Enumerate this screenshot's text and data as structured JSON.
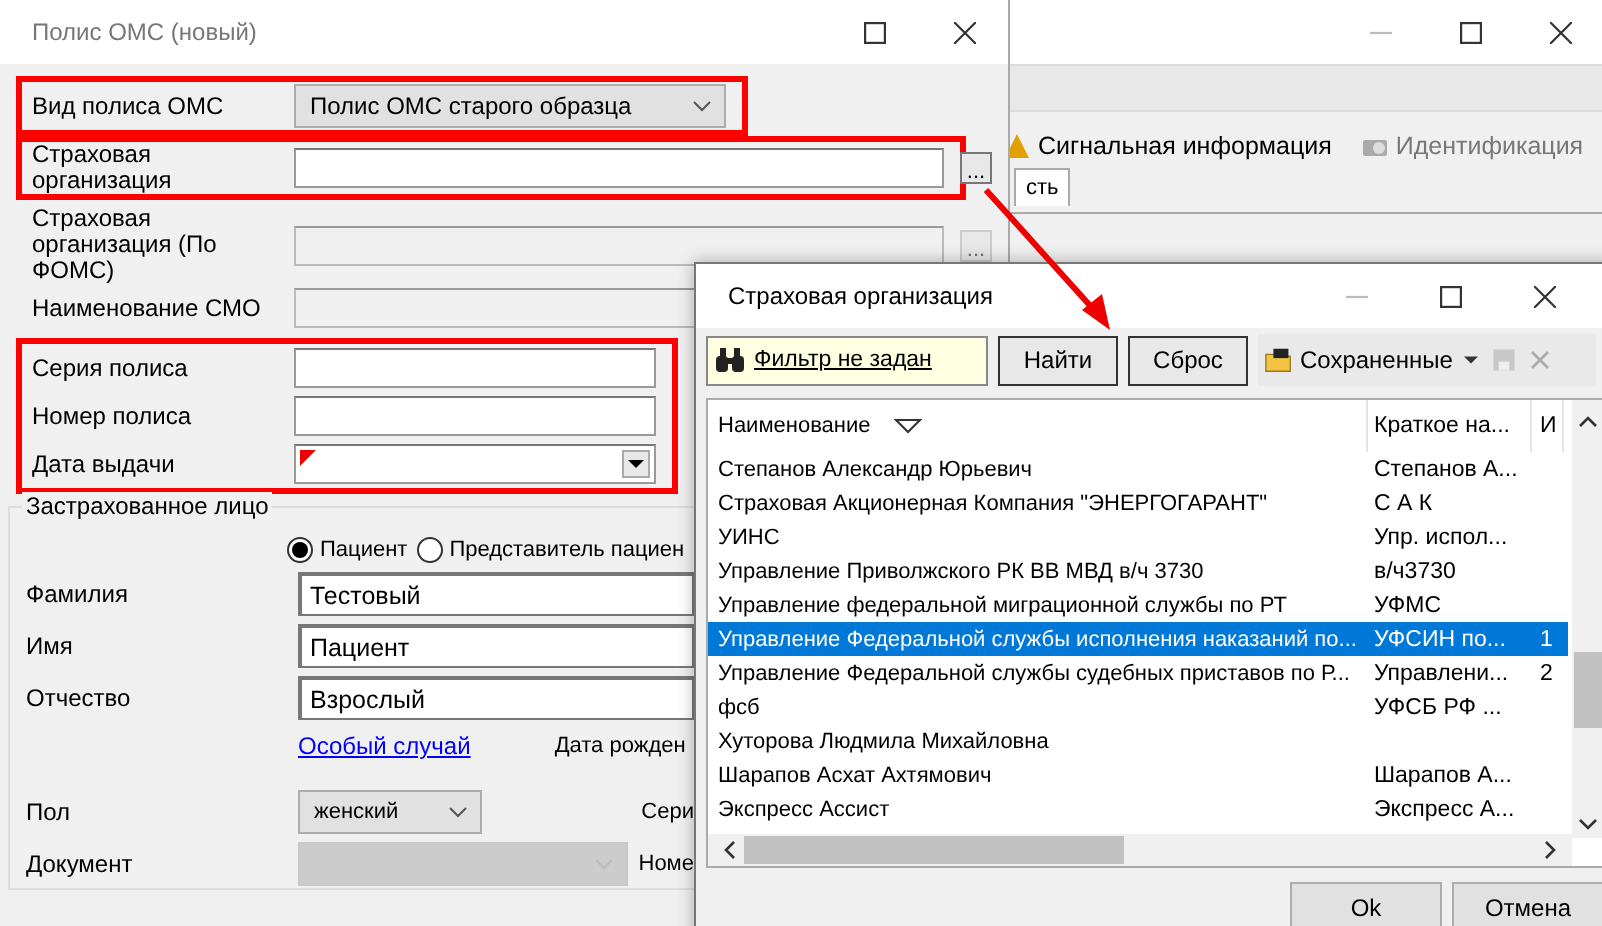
{
  "background_window": {
    "toolbar": [
      {
        "label": "Сигнальная информация",
        "disabled": false
      },
      {
        "label": "Идентификация",
        "disabled": true
      }
    ],
    "tab": {
      "label": "сть"
    }
  },
  "policy_dialog": {
    "title": "Полис ОМС (новый)",
    "groups": [
      {
        "highlighted": true,
        "fields": [
          {
            "kind": "select",
            "label": "Вид полиса ОМС",
            "value": "Полис ОМС старого образца",
            "disabled": false
          }
        ]
      },
      {
        "highlighted": true,
        "fields": [
          {
            "kind": "lookup",
            "label": "Страховая организация",
            "browse_label": "...",
            "disabled": false
          }
        ]
      },
      {
        "highlighted": false,
        "fields": [
          {
            "kind": "lookup",
            "label": "Страховая  организация (По ФОМС)",
            "browse_label": "...",
            "disabled": true
          },
          {
            "kind": "text",
            "label": "Наименование СМО",
            "disabled": true
          }
        ]
      },
      {
        "highlighted": true,
        "fields": [
          {
            "kind": "text",
            "label": "Серия полиса",
            "disabled": false
          },
          {
            "kind": "text",
            "label": "Номер полиса",
            "disabled": false
          },
          {
            "kind": "date",
            "label": "Дата выдачи",
            "required": true,
            "disabled": false
          }
        ]
      }
    ],
    "insured": {
      "title": "Застрахованное лицо",
      "radios": [
        {
          "label": "Пациент",
          "selected": true
        },
        {
          "label": "Представитель пациен",
          "selected": false
        }
      ],
      "name_fields": [
        {
          "label": "Фамилия",
          "value": "Тестовый"
        },
        {
          "label": "Имя",
          "value": "Пациент"
        },
        {
          "label": "Отчество",
          "value": "Взрослый"
        }
      ],
      "special_case_link": "Особый случай",
      "birth_date_label": "Дата рожден",
      "sex": {
        "label": "Пол",
        "value": "женский",
        "disabled": false
      },
      "series_label": "Сери",
      "document": {
        "label": "Документ",
        "disabled": true
      },
      "number_label": "Номе"
    }
  },
  "org_dialog": {
    "title": "Страховая организация",
    "filter": "Фильтр не задан",
    "find_button": "Найти",
    "reset_button": "Сброс",
    "saved_menu": "Сохраненные",
    "columns": [
      "Наименование",
      "Краткое на...",
      "И"
    ],
    "rows": [
      {
        "name": "Степанов Александр Юрьевич",
        "short": "Степанов А...",
        "column_3": "",
        "selected": false
      },
      {
        "name": "Страховая Акционерная Компания \"ЭНЕРГОГАРАНТ\"",
        "short": "С А К",
        "column_3": "",
        "selected": false
      },
      {
        "name": "УИНС",
        "short": "Упр. испол...",
        "column_3": "",
        "selected": false
      },
      {
        "name": "Управление Приволжского РК ВВ МВД  в/ч 3730",
        "short": "в/ч3730",
        "column_3": "",
        "selected": false
      },
      {
        "name": "Управление федеральной миграционной службы по РТ",
        "short": "УФМС",
        "column_3": "",
        "selected": false
      },
      {
        "name": "Управление Федеральной службы исполнения наказаний по...",
        "short": "УФСИН по...",
        "column_3": "1",
        "selected": true
      },
      {
        "name": "Управление Федеральной службы судебных приставов по Р...",
        "short": "Управлени...",
        "column_3": "2",
        "selected": false
      },
      {
        "name": "фсб",
        "short": "УФСБ РФ ...",
        "column_3": "",
        "selected": false
      },
      {
        "name": "Хуторова Людмила Михайловна",
        "short": "",
        "column_3": "",
        "selected": false
      },
      {
        "name": "Шарапов Асхат Ахтямович",
        "short": "Шарапов А...",
        "column_3": "",
        "selected": false
      },
      {
        "name": "Экспресс Ассист",
        "short": "Экспресс А...",
        "column_3": "",
        "selected": false
      }
    ],
    "ok_button": "Ok",
    "cancel_button": "Отмена"
  }
}
